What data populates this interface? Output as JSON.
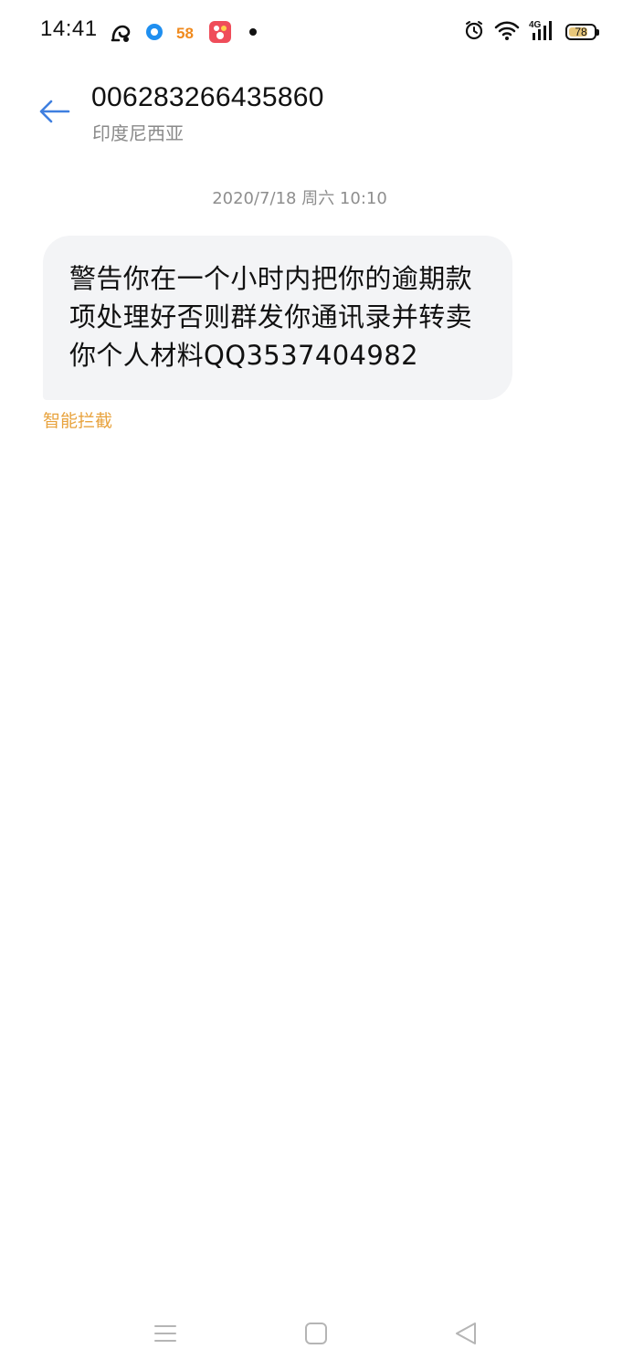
{
  "status_bar": {
    "time": "14:41",
    "left_icons": [
      "uc-browser-icon",
      "browser-circle-icon",
      "app-58-icon",
      "app-red-icon",
      "notification-dot-icon"
    ],
    "app_58_label": "58",
    "right_icons": [
      "alarm-icon",
      "wifi-icon",
      "4g-signal-icon",
      "battery-icon"
    ],
    "network_label": "4G",
    "battery_level": "78",
    "battery_fraction": 0.78
  },
  "header": {
    "back_icon": "arrow-left-icon",
    "contact_number": "006283266435860",
    "contact_region": "印度尼西亚"
  },
  "conversation": {
    "timestamp": "2020/7/18 周六 10:10",
    "messages": [
      {
        "text": "警告你在一个小时内把你的逾期款项处理好否则群发你通讯录并转卖你个人材料QQ3537404982",
        "tag": "智能拦截"
      }
    ]
  },
  "colors": {
    "accent_blue": "#3f7fe0",
    "bubble_bg": "#f3f4f6",
    "tag_orange": "#e8a33e",
    "secondary_text": "#8a8a8a"
  },
  "nav_bar": {
    "icons": [
      "menu-icon",
      "home-square-icon",
      "back-triangle-icon"
    ]
  }
}
